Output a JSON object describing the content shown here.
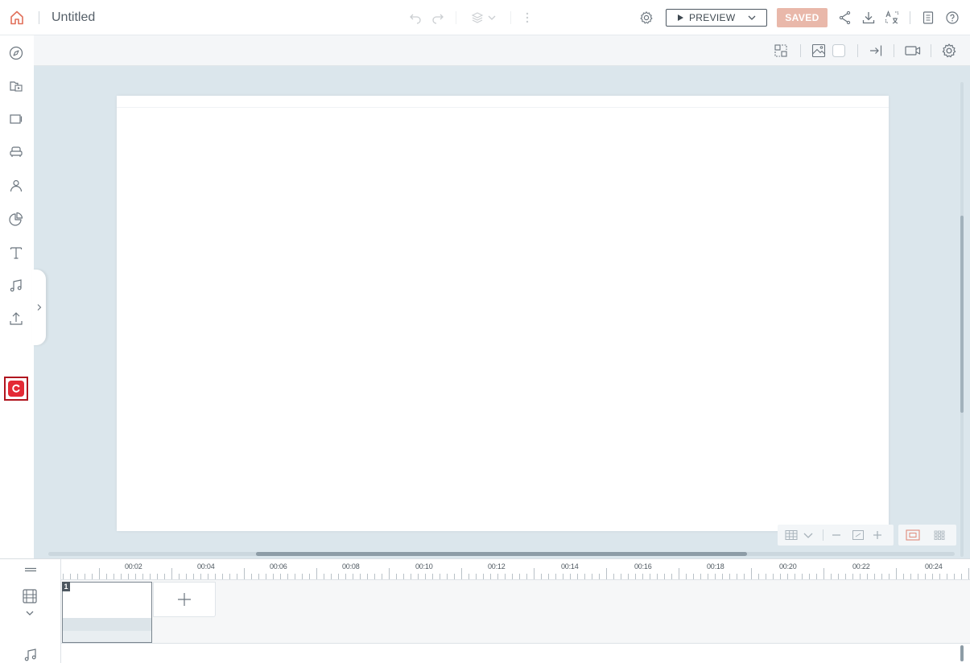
{
  "header": {
    "title": "Untitled",
    "preview_label": "PREVIEW",
    "saved_label": "SAVED"
  },
  "sidebar": {
    "items": [
      "compass-icon",
      "folder-media-icon",
      "frames-icon",
      "props-icon",
      "character-icon",
      "chart-icon",
      "text-icon",
      "music-icon",
      "upload-icon",
      "brand-app-icon"
    ]
  },
  "timeline": {
    "marks": [
      "00:02",
      "00:04",
      "00:06",
      "00:08",
      "00:10",
      "00:12",
      "00:14",
      "00:16",
      "00:18",
      "00:20",
      "00:22",
      "00:24"
    ],
    "scene_number": "1"
  },
  "colors": {
    "accent": "#e42a35",
    "saved_bg": "#e9b8aa",
    "workspace_bg": "#dbe6ec"
  }
}
